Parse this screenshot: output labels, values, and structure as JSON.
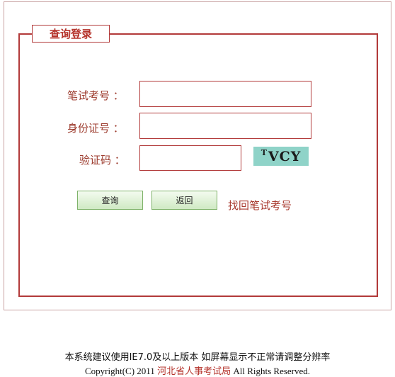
{
  "panel": {
    "title": "查询登录"
  },
  "form": {
    "exam_number_label": "笔试考号 ：",
    "id_number_label": "身份证号 ：",
    "captcha_label": "验证码 ：",
    "exam_number_value": "",
    "id_number_value": "",
    "captcha_value": "",
    "captcha_image_sup": "T",
    "captcha_image_text": "VCY"
  },
  "buttons": {
    "query": "查询",
    "back": "返回"
  },
  "links": {
    "recover_exam_number": "找回笔试考号"
  },
  "footer": {
    "notice": "本系统建议使用IE7.0及以上版本  如屏幕显示不正常请调整分辨率",
    "copyright_prefix": "Copyright(C) 2011 ",
    "organization": "河北省人事考试局",
    "copyright_suffix": "  All Rights Reserved."
  },
  "colors": {
    "border": "#b23a3a",
    "label": "#9c3a2c",
    "button_gradient_top": "#f4fbf0",
    "button_gradient_bottom": "#cfe9c3",
    "captcha_bg": "#8fd3c8"
  }
}
